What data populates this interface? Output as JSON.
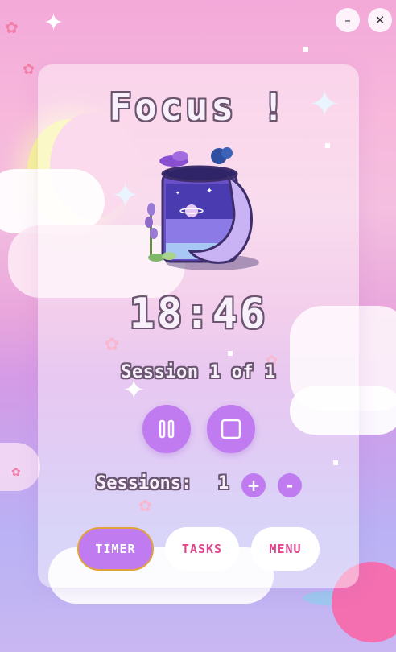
{
  "window": {
    "minimize_icon": "minimize-icon",
    "close_icon": "close-icon"
  },
  "title": "Focus !",
  "timer": {
    "display": "18:46"
  },
  "session": {
    "text": "Session 1 of 1"
  },
  "controls": {
    "pause_icon": "pause-icon",
    "stop_icon": "stop-icon"
  },
  "sessions": {
    "label": "Sessions:",
    "count": "1",
    "plus": "+",
    "minus": "-"
  },
  "tabs": [
    {
      "label": "TIMER",
      "active": true
    },
    {
      "label": "TASKS",
      "active": false
    },
    {
      "label": "MENU",
      "active": false
    }
  ],
  "colors": {
    "accent": "#c07bf0",
    "tab_text": "#e0468e",
    "active_border": "#e0a33d"
  }
}
